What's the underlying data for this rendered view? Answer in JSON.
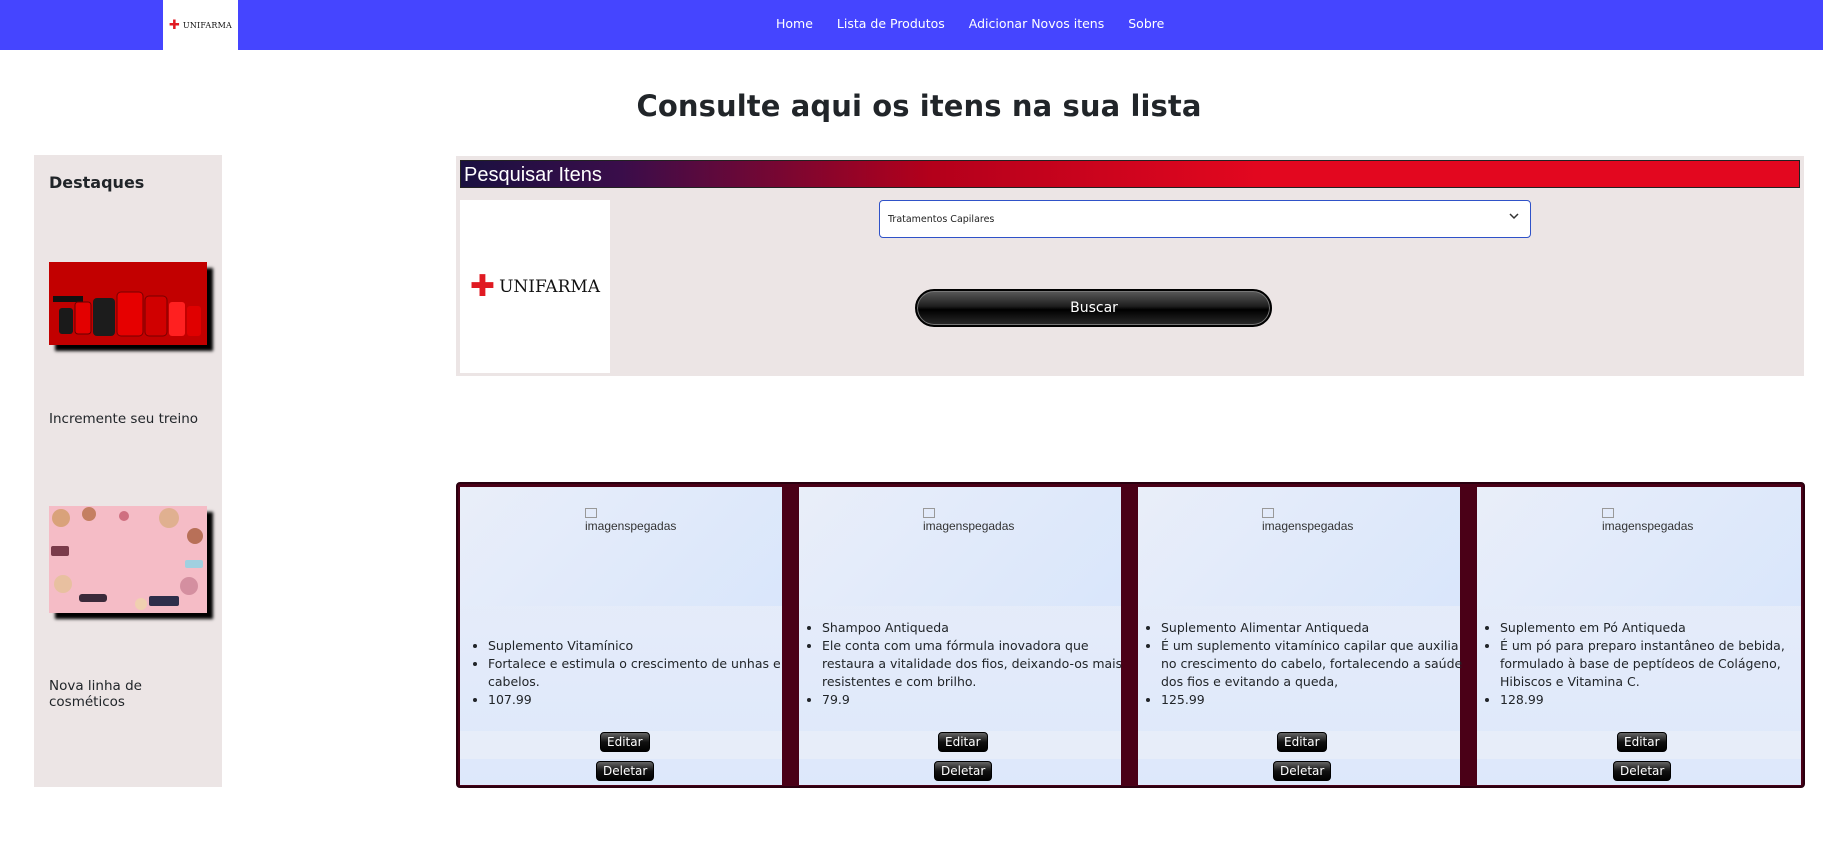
{
  "navbar": {
    "brand": "UNIFARMA",
    "links": [
      "Home",
      "Lista de Produtos",
      "Adicionar Novos itens",
      "Sobre"
    ]
  },
  "page": {
    "title": "Consulte aqui os itens na sua lista"
  },
  "sidebar": {
    "title": "Destaques",
    "items": [
      {
        "caption": "Incremente seu treino",
        "image": "supplement-products-banner"
      },
      {
        "caption": "Nova linha de cosméticos",
        "image": "cosmetics-banner"
      }
    ]
  },
  "search": {
    "header": "Pesquisar Itens",
    "logo": "UNIFARMA",
    "selected_category": "Tratamentos Capilares",
    "button_label": "Buscar"
  },
  "products": [
    {
      "image_alt": "imagenspegadas",
      "name": "Suplemento Vitamínico",
      "description": "Fortalece e estimula o crescimento de unhas e cabelos.",
      "price": "107.99",
      "edit_label": "Editar",
      "delete_label": "Deletar"
    },
    {
      "image_alt": "imagenspegadas",
      "name": "Shampoo Antiqueda",
      "description": "Ele conta com uma fórmula inovadora que restaura a vitalidade dos fios, deixando-os mais resistentes e com brilho.",
      "price": "79.9",
      "edit_label": "Editar",
      "delete_label": "Deletar"
    },
    {
      "image_alt": "imagenspegadas",
      "name": "Suplemento Alimentar Antiqueda",
      "description": "É um suplemento vitamínico capilar que auxilia no crescimento do cabelo, fortalecendo a saúde dos fios e evitando a queda,",
      "price": "125.99",
      "edit_label": "Editar",
      "delete_label": "Deletar"
    },
    {
      "image_alt": "imagenspegadas",
      "name": "Suplemento em Pó Antiqueda",
      "description": "É um pó para preparo instantâneo de bebida, formulado à base de peptídeos de Colágeno, Hibiscos e Vitamina C.",
      "price": "128.99",
      "edit_label": "Editar",
      "delete_label": "Deletar"
    }
  ],
  "colors": {
    "navbar": "#4545ff",
    "panel": "#ece5e5",
    "grid_border": "#4a0017",
    "header_red": "#e3071f"
  }
}
